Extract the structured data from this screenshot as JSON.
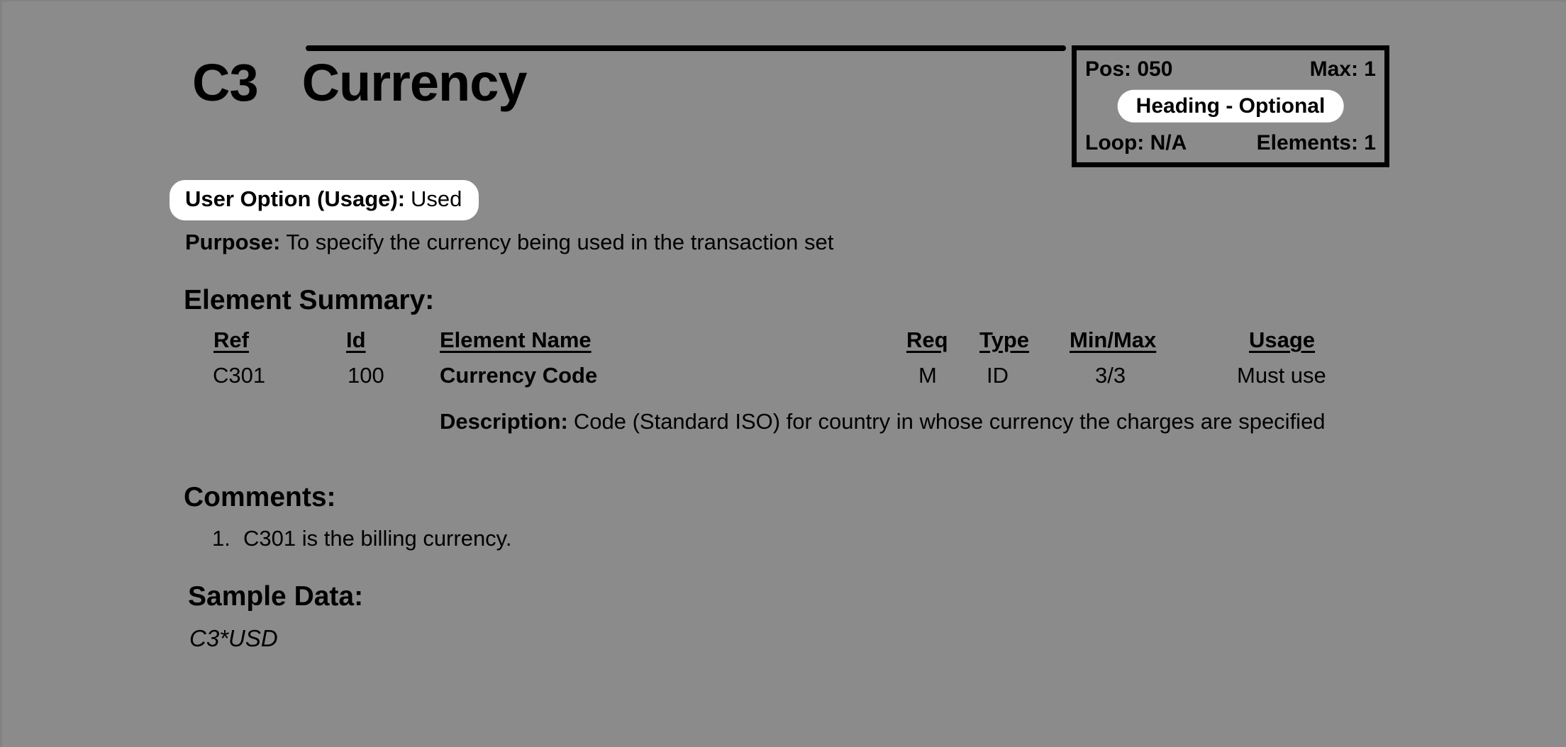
{
  "segment": {
    "id": "C3",
    "name": "Currency"
  },
  "info_box": {
    "pos": "Pos: 050",
    "max": "Max: 1",
    "area_requirement": "Heading - Optional",
    "loop": "Loop: N/A",
    "elements": "Elements: 1"
  },
  "user_option": {
    "label": "User Option (Usage):",
    "value": "Used"
  },
  "purpose": {
    "label": "Purpose:",
    "value": "To specify the currency being used in the transaction set"
  },
  "element_summary": {
    "heading": "Element Summary:",
    "columns": {
      "ref": "Ref",
      "id": "Id",
      "name": "Element Name",
      "req": "Req",
      "type": "Type",
      "minmax": "Min/Max",
      "usage": "Usage"
    },
    "rows": [
      {
        "ref": "C301",
        "id": "100",
        "name": "Currency Code",
        "req": "M",
        "type": "ID",
        "minmax": "3/3",
        "usage": "Must use",
        "description_label": "Description:",
        "description_value": "Code (Standard ISO) for country in whose currency the charges are specified"
      }
    ]
  },
  "comments": {
    "heading": "Comments:",
    "items": [
      {
        "number": "1.",
        "text": "C301 is the billing currency."
      }
    ]
  },
  "sample_data": {
    "heading": "Sample Data:",
    "lines": [
      "C3*USD"
    ]
  },
  "colors": {
    "background": "#8b8b8b",
    "text": "#000000",
    "pill_background": "#ffffff"
  }
}
